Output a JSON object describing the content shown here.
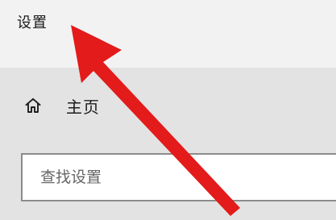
{
  "window": {
    "title": "设置"
  },
  "navigation": {
    "home_label": "主页",
    "home_icon": "home-icon"
  },
  "search": {
    "placeholder": "查找设置",
    "value": ""
  },
  "annotation": {
    "type": "arrow",
    "color": "#e31b1b"
  },
  "colors": {
    "title_background": "#f2f2f2",
    "nav_background": "#e3e3e3",
    "search_border": "#8c8c8c",
    "annotation_red": "#e31b1b"
  }
}
